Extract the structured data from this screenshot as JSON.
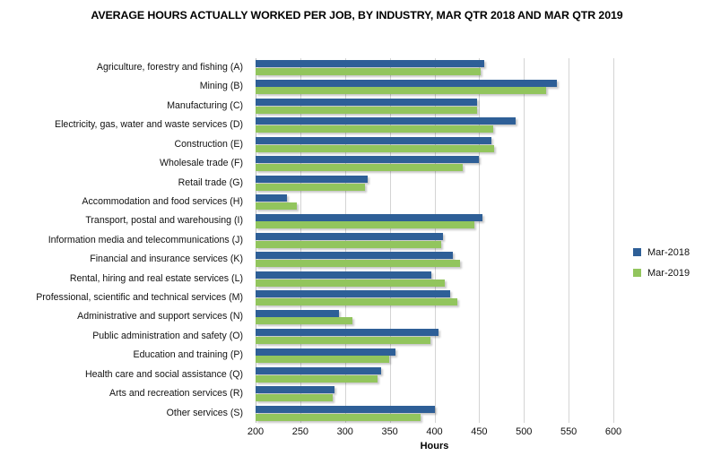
{
  "chart_data": {
    "type": "bar",
    "orientation": "horizontal",
    "title": "AVERAGE HOURS ACTUALLY WORKED PER JOB, BY INDUSTRY, MAR QTR 2018 AND MAR QTR 2019",
    "xlabel": "Hours",
    "ylabel": "",
    "xlim": [
      200,
      600
    ],
    "xticks": [
      200,
      250,
      300,
      350,
      400,
      450,
      500,
      550,
      600
    ],
    "grid": true,
    "legend_position": "right",
    "categories": [
      "Agriculture, forestry and fishing (A)",
      "Mining (B)",
      "Manufacturing (C)",
      "Electricity, gas, water and waste services (D)",
      "Construction (E)",
      "Wholesale trade (F)",
      "Retail trade (G)",
      "Accommodation and food services (H)",
      "Transport, postal and warehousing (I)",
      "Information media and telecommunications (J)",
      "Financial and insurance services (K)",
      "Rental, hiring and real estate services (L)",
      "Professional, scientific and technical services (M)",
      "Administrative and support services (N)",
      "Public administration and safety (O)",
      "Education and training (P)",
      "Health care and social assistance (Q)",
      "Arts and recreation services (R)",
      "Other services (S)"
    ],
    "series": [
      {
        "name": "Mar-2018",
        "color": "#2e5f97",
        "values": [
          456,
          537,
          448,
          491,
          464,
          450,
          325,
          235,
          454,
          410,
          421,
          396,
          418,
          293,
          405,
          356,
          340,
          288,
          400
        ]
      },
      {
        "name": "Mar-2019",
        "color": "#92c55d",
        "values": [
          452,
          525,
          448,
          466,
          467,
          432,
          322,
          246,
          445,
          408,
          429,
          412,
          426,
          308,
          395,
          349,
          336,
          286,
          384
        ]
      }
    ]
  }
}
